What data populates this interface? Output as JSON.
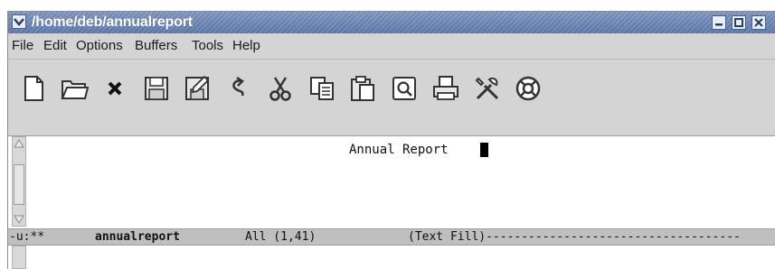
{
  "window": {
    "title": "/home/deb/annualreport"
  },
  "menubar": {
    "items": [
      "File",
      "Edit",
      "Options",
      "Buffers",
      "Tools",
      "Help"
    ]
  },
  "toolbar": {
    "icons": [
      "new-file-icon",
      "open-folder-icon",
      "close-icon",
      "save-icon",
      "save-as-icon",
      "undo-icon",
      "cut-icon",
      "copy-icon",
      "paste-icon",
      "search-icon",
      "print-icon",
      "preferences-icon",
      "help-icon"
    ]
  },
  "buffer": {
    "text": "Annual Report"
  },
  "modeline": {
    "prefix": "-u:**",
    "buffer_name": "annualreport",
    "position": "All (1,41)",
    "mode": "(Text Fill)------------------------------------"
  },
  "colors": {
    "titlebar": "#6c86b8",
    "chrome": "#d4d4d4",
    "modeline": "#bfbfbf"
  }
}
